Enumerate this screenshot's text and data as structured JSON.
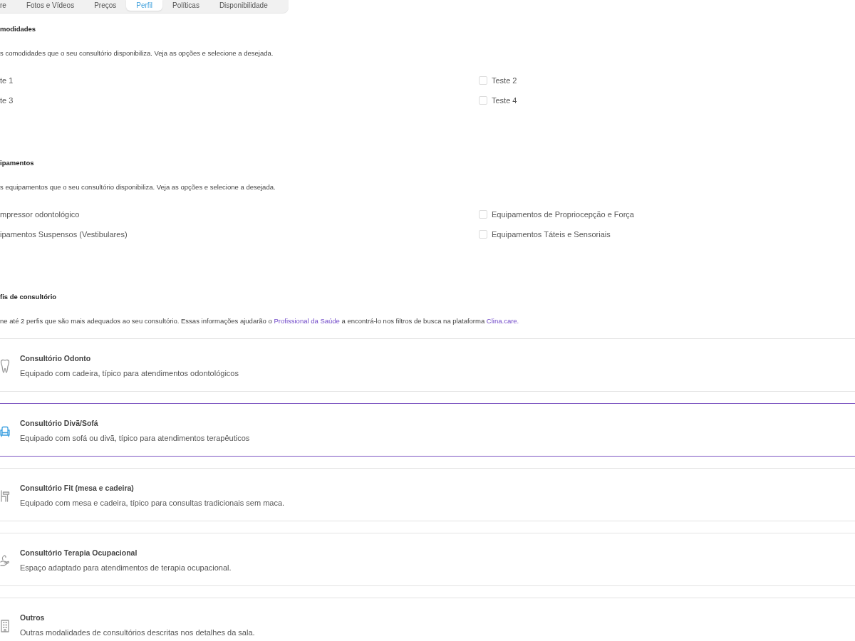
{
  "tabs": [
    {
      "label": "re",
      "selected": false
    },
    {
      "label": "Fotos e Vídeos",
      "selected": false
    },
    {
      "label": "Preços",
      "selected": false
    },
    {
      "label": "Perfil",
      "selected": true
    },
    {
      "label": "Políticas",
      "selected": false
    },
    {
      "label": "Disponibilidade",
      "selected": false
    }
  ],
  "sections": [
    {
      "kind": "checklist",
      "title": "modidades",
      "description": "s comodidades que o seu consultório disponibiliza. Veja as opções e selecione a desejada.",
      "items": [
        {
          "label": "te 1"
        },
        {
          "label": "Teste 2",
          "checked": false
        },
        {
          "label": "te 3"
        },
        {
          "label": "Teste 4",
          "checked": false
        }
      ]
    },
    {
      "kind": "checklist",
      "title": "ipamentos",
      "description": "s equipamentos que o seu consultório disponibiliza. Veja as opções e selecione a desejada.",
      "items": [
        {
          "label": "mpressor odontológico"
        },
        {
          "label": "Equipamentos de Propriocepção e Força",
          "checked": false
        },
        {
          "label": "ipamentos Suspensos (Vestibulares)"
        },
        {
          "label": "Equipamentos Táteis e Sensoriais",
          "checked": false
        }
      ]
    },
    {
      "kind": "profiles",
      "title": "fis de consultório",
      "description": [
        {
          "kind": "text",
          "text": "ne até 2 perfis que são mais adequados ao seu consultório. Essas informações ajudarão o "
        },
        {
          "kind": "link",
          "text": "Profissional da Saúde"
        },
        {
          "kind": "text",
          "text": " a encontrá-lo nos filtros de busca na plataforma "
        },
        {
          "kind": "link",
          "text": "Clina.care."
        }
      ],
      "options": [
        {
          "title": "Consultório Odonto",
          "description": "Equipado com cadeira, típico para atendimentos odontológicos",
          "selected": false
        },
        {
          "title": "Consultório Divã/Sofá",
          "description": "Equipado com sofá ou divã, típico para atendimentos terapêuticos",
          "selected": true
        },
        {
          "title": "Consultório Fit (mesa e cadeira)",
          "description": "Equipado com mesa e cadeira, típico para consultas tradicionais sem maca.",
          "selected": false
        },
        {
          "title": "Consultório Terapia Ocupacional",
          "description": "Espaço adaptado para atendimentos de terapia ocupacional.",
          "selected": false
        },
        {
          "title": "Outros",
          "description": "Outras modalidades de consultórios descritas nos detalhes da sala.",
          "selected": false
        }
      ]
    }
  ]
}
